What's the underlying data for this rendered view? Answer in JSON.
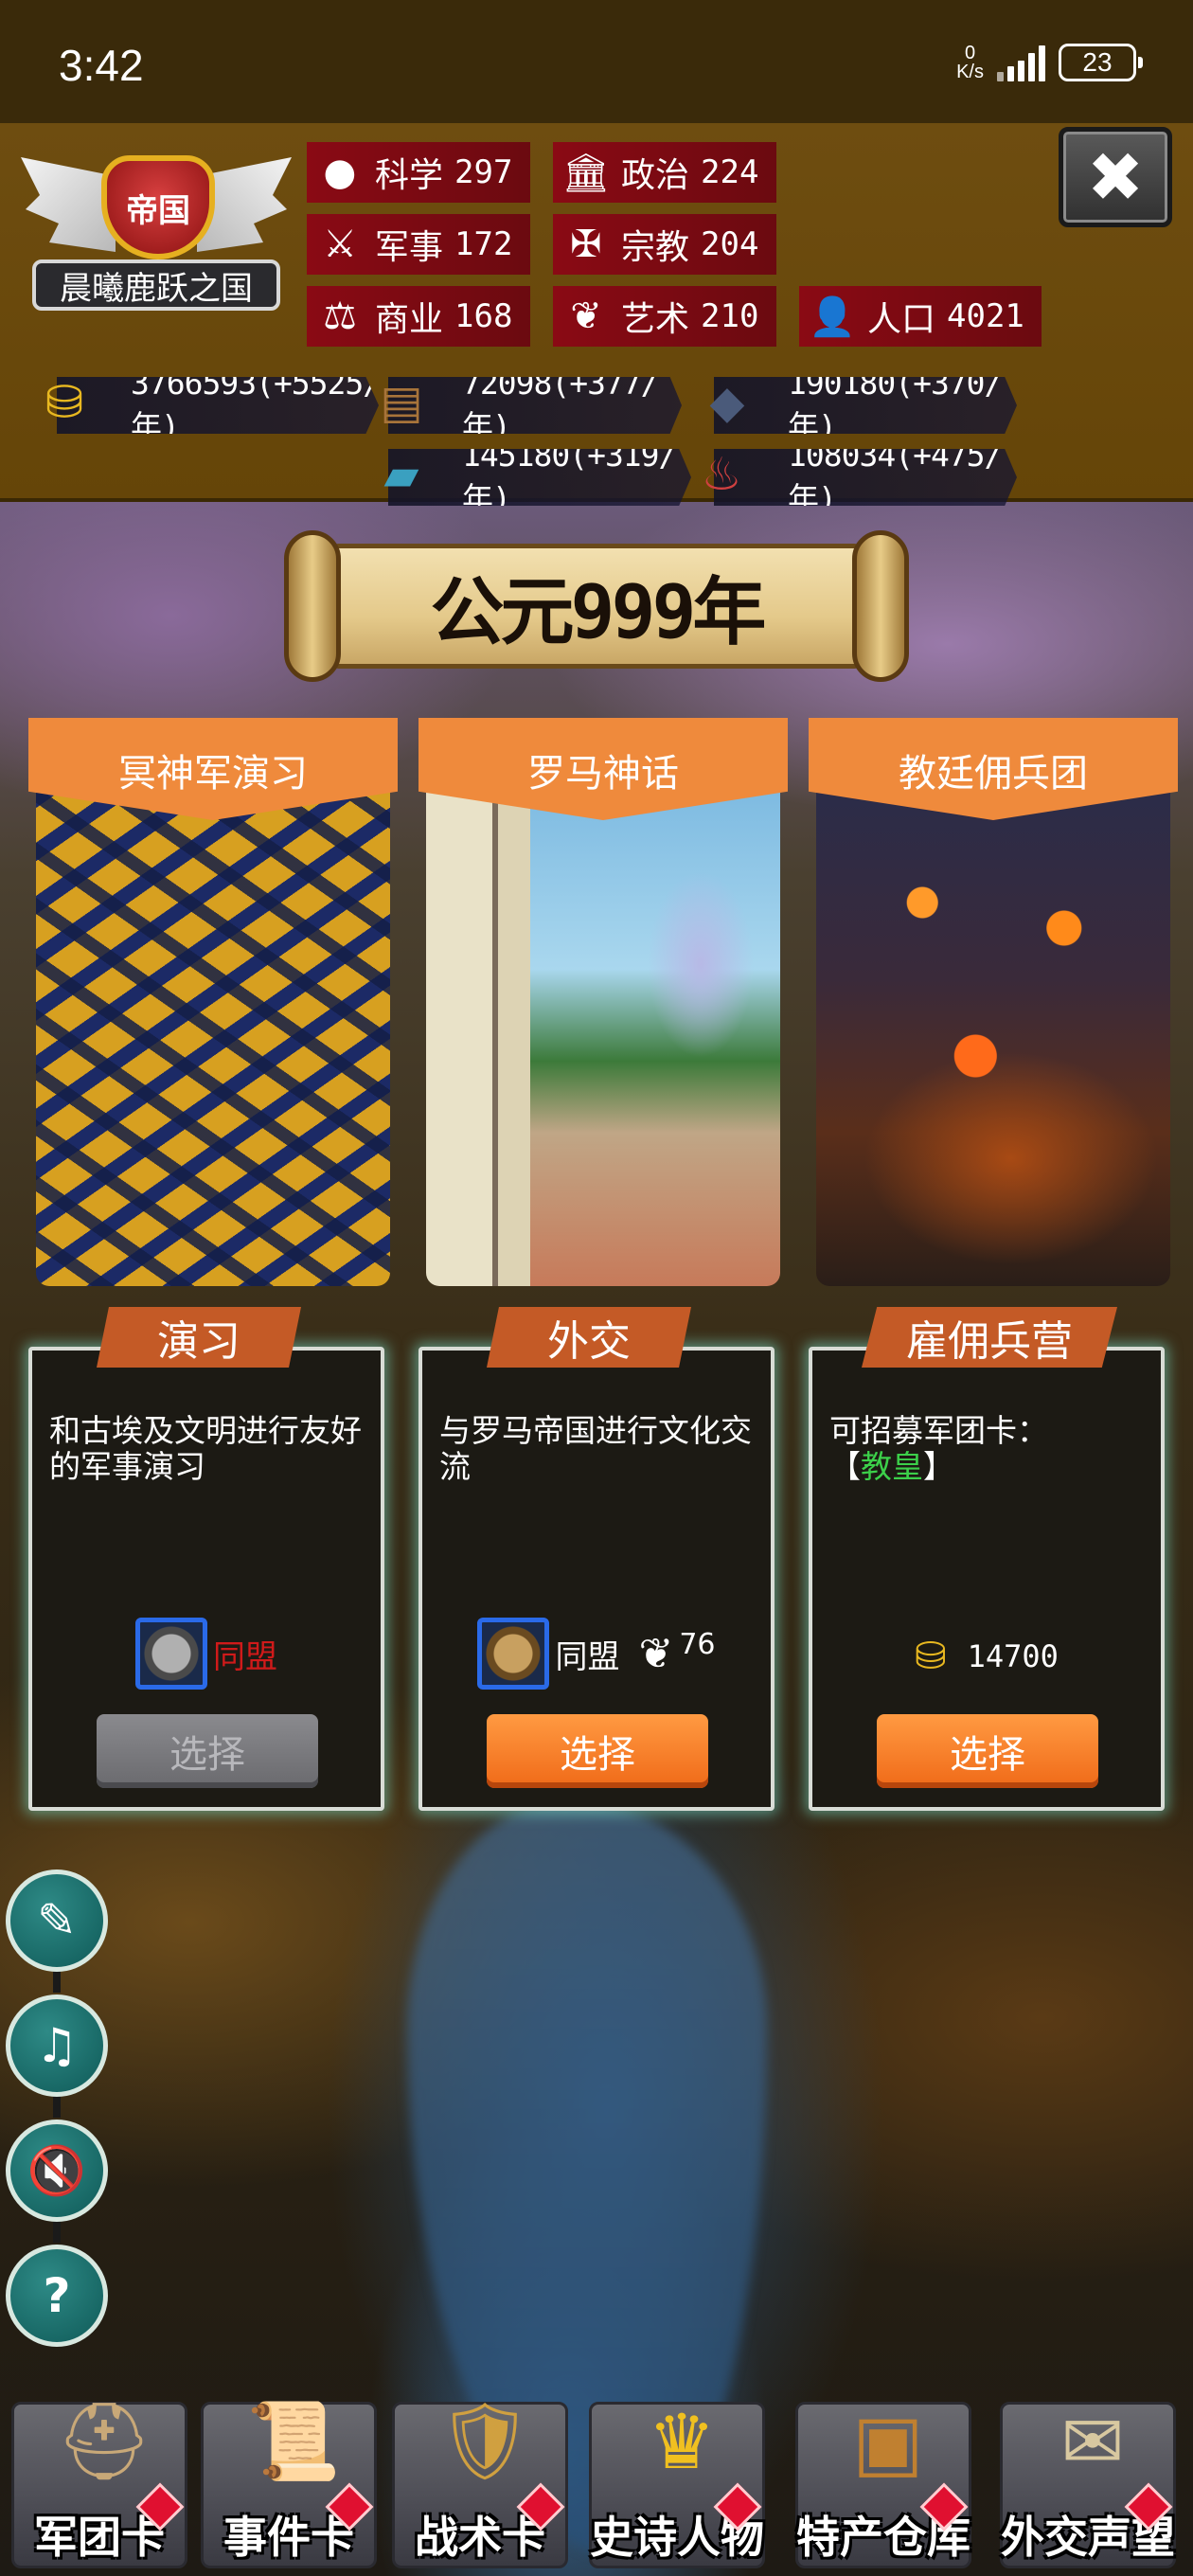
{
  "status_bar": {
    "time": "3:42",
    "net_speed_value": "0",
    "net_speed_unit": "K/s",
    "battery": "23"
  },
  "empire": {
    "badge": "帝国",
    "name": "晨曦鹿跃之国"
  },
  "stats": {
    "science": {
      "label": "科学",
      "value": "297"
    },
    "politics": {
      "label": "政治",
      "value": "224"
    },
    "military": {
      "label": "军事",
      "value": "172"
    },
    "religion": {
      "label": "宗教",
      "value": "204"
    },
    "commerce": {
      "label": "商业",
      "value": "168"
    },
    "art": {
      "label": "艺术",
      "value": "210"
    },
    "population": {
      "label": "人口",
      "value": "4021"
    }
  },
  "resources": {
    "gold": "3766593(+5525/年)",
    "wood": "72098(+377/年)",
    "stone": "190180(+370/年)",
    "iron": "145180(+319/年)",
    "food": "108034(+475/年)"
  },
  "year_banner": "公元999年",
  "cards": [
    {
      "title": "冥神军演习",
      "tab": "演习",
      "description": "和古埃及文明进行友好的军事演习",
      "cost_label": "同盟",
      "button": "选择",
      "enabled": false
    },
    {
      "title": "罗马神话",
      "tab": "外交",
      "description": "与罗马帝国进行文化交流",
      "cost_label": "同盟",
      "cost_value": "76",
      "button": "选择",
      "enabled": true
    },
    {
      "title": "教廷佣兵团",
      "tab": "雇佣兵营",
      "description_prefix": "可招募军团卡：",
      "description_open": "【",
      "description_highlight": "教皇",
      "description_close": "】",
      "cost_value": "14700",
      "button": "选择",
      "enabled": true
    }
  ],
  "side_tools": [
    "document-sign-icon",
    "music-off-icon",
    "sound-off-icon",
    "help-icon"
  ],
  "side_tool_glyphs": {
    "help": "?"
  },
  "bottom_nav": [
    {
      "label": "军团卡",
      "icon": "helmet-icon"
    },
    {
      "label": "事件卡",
      "icon": "scroll-icon"
    },
    {
      "label": "战术卡",
      "icon": "shield-swords-icon"
    },
    {
      "label": "史诗人物",
      "icon": "crown-icon"
    },
    {
      "label": "特产仓库",
      "icon": "treasure-chest-icon"
    },
    {
      "label": "外交声望",
      "icon": "envelope-icon"
    }
  ],
  "colors": {
    "header_bg": "#6e4d10",
    "stat_bg": "#8a0a14",
    "card_header": "#ef8a3c",
    "card_tab": "#c45a26",
    "button_active": "#f06a18",
    "button_disabled": "#7a7a7e",
    "alliance_unavailable": "#d01a1a",
    "highlight_green": "#3cd04a"
  }
}
